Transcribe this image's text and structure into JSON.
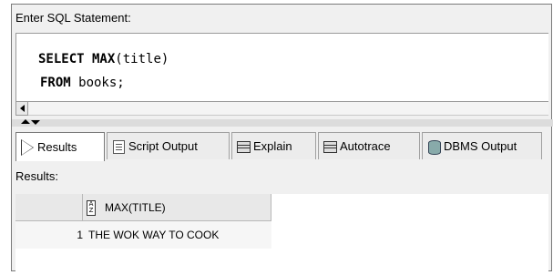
{
  "editor": {
    "label": "Enter SQL Statement:",
    "line1_kw": "SELECT MAX",
    "line1_rest": "(title)",
    "line2_kw": "FROM",
    "line2_rest": " books;"
  },
  "tabs": [
    {
      "label": "Results",
      "icon": "run-icon",
      "active": true
    },
    {
      "label": "Script Output",
      "icon": "script-icon",
      "active": false
    },
    {
      "label": "Explain",
      "icon": "explain-icon",
      "active": false
    },
    {
      "label": "Autotrace",
      "icon": "autotrace-icon",
      "active": false
    },
    {
      "label": "DBMS Output",
      "icon": "dbms-icon",
      "active": false
    }
  ],
  "results": {
    "label": "Results:",
    "columns": [
      "MAX(TITLE)"
    ],
    "rows": [
      {
        "num": "1",
        "cells": [
          "THE WOK WAY TO COOK"
        ]
      }
    ]
  }
}
